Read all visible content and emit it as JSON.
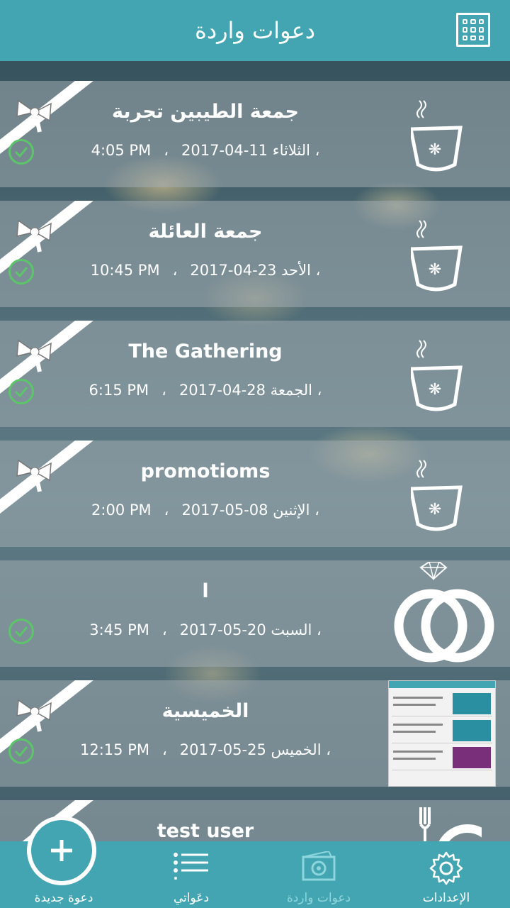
{
  "header": {
    "title": "دعوات واردة",
    "menu_icon": "grid-logo-icon"
  },
  "invitations": [
    {
      "title": "جمعة الطيبين تجربة",
      "day": "الثلاثاء ،",
      "date": "2017-04-11",
      "time": "4:05 PM",
      "icon": "cup-icon",
      "ribbon": true,
      "checked": true
    },
    {
      "title": "جمعة العائلة",
      "day": "الأحد ،",
      "date": "2017-04-23",
      "time": "10:45 PM",
      "icon": "cup-icon",
      "ribbon": true,
      "checked": true
    },
    {
      "title": "The Gathering",
      "day": "الجمعة ،",
      "date": "2017-04-28",
      "time": "6:15 PM",
      "icon": "cup-icon",
      "ribbon": true,
      "checked": true
    },
    {
      "title": "promotioms",
      "day": "الإثنين ،",
      "date": "2017-05-08",
      "time": "2:00 PM",
      "icon": "cup-icon",
      "ribbon": true,
      "checked": false
    },
    {
      "title": "ا",
      "day": "السبت ،",
      "date": "2017-05-20",
      "time": "3:45 PM",
      "icon": "rings-icon",
      "ribbon": false,
      "checked": true
    },
    {
      "title": "الخميسية",
      "day": "الخميس ،",
      "date": "2017-05-25",
      "time": "12:15 PM",
      "icon": "thumbnail-image",
      "ribbon": true,
      "checked": true
    },
    {
      "title": "test user",
      "icon": "plate-cutlery-icon",
      "ribbon": true,
      "checked": false
    }
  ],
  "meta_separator": "،",
  "tabs": [
    {
      "label": "دعوة جديدة",
      "icon": "plus-icon"
    },
    {
      "label": "دعَواتي",
      "icon": "list-icon"
    },
    {
      "label": "دعوات واردة",
      "icon": "inbox-card-icon"
    },
    {
      "label": "الإعدادات",
      "icon": "gear-icon"
    }
  ],
  "colors": {
    "primary": "#43a5b1",
    "check": "#5cc56a",
    "inactive_tab": "#8ed6de"
  }
}
